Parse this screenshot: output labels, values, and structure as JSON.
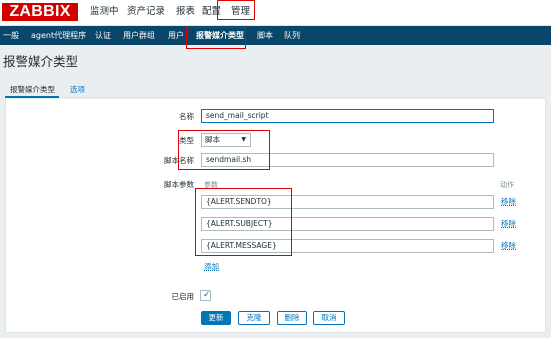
{
  "header": {
    "logo": "ZABBIX",
    "menu": [
      "监测中",
      "资产记录",
      "报表",
      "配置",
      "管理"
    ]
  },
  "subnav": {
    "items": [
      "一般",
      "agent代理程序",
      "认证",
      "用户群组",
      "用户",
      "报警媒介类型",
      "脚本",
      "队列"
    ],
    "active": "报警媒介类型"
  },
  "page": {
    "title": "报警媒介类型"
  },
  "tabs": {
    "items": [
      "报警媒介类型",
      "选项"
    ],
    "active": "报警媒介类型"
  },
  "form": {
    "name_label": "名称",
    "name_value": "send_mail_script",
    "type_label": "类型",
    "type_value": "脚本",
    "script_name_label": "脚本名称",
    "script_name_value": "sendmail.sh",
    "script_params_label": "脚本参数",
    "params_header": "参数",
    "actions_header": "动作",
    "params": [
      "{ALERT.SENDTO}",
      "{ALERT.SUBJECT}",
      "{ALERT.MESSAGE}"
    ],
    "remove_label": "移除",
    "add_label": "添加",
    "enabled_label": "已启用",
    "enabled": true
  },
  "buttons": {
    "update": "更新",
    "clone": "克隆",
    "delete": "删除",
    "cancel": "取消"
  },
  "colors": {
    "brand_red": "#d40000",
    "nav_dark": "#0a466a",
    "link_blue": "#0275b8",
    "highlight_red": "#e00000"
  }
}
